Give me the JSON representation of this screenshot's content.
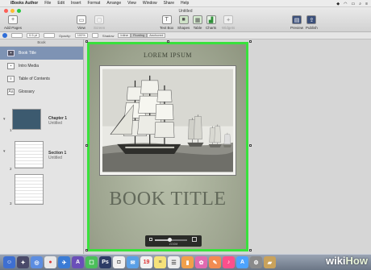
{
  "menubar": {
    "app": "iBooks Author",
    "menus": [
      "File",
      "Edit",
      "Insert",
      "Format",
      "Arrange",
      "View",
      "Window",
      "Share",
      "Help"
    ]
  },
  "window": {
    "title": "Untitled"
  },
  "toolbar": {
    "add_pages": "Add Pages",
    "view": "View",
    "screen": "Screen",
    "text_box": "Text Box",
    "shapes": "Shapes",
    "table": "Table",
    "charts": "Charts",
    "widgets": "Widgets",
    "preview": "Preview",
    "publish": "Publish"
  },
  "formatbar": {
    "stroke_width": "0.5 pt",
    "opacity_label": "Opacity:",
    "opacity_value": "100%",
    "shadow_label": "Shadow",
    "wrap_modes": [
      "Inline",
      "Floating",
      "Anchored"
    ],
    "selected_wrap": "Floating"
  },
  "sidebar": {
    "header": "Book",
    "items": [
      {
        "label": "Book Title",
        "active": true
      },
      {
        "label": "Intro Media",
        "active": false
      },
      {
        "label": "Table of Contents",
        "active": false
      },
      {
        "label": "Glossary",
        "active": false
      }
    ],
    "chapters": [
      {
        "num": "1",
        "title": "Chapter 1",
        "subtitle": "Untitled"
      },
      {
        "num": "2",
        "title": "Section 1",
        "subtitle": "Untitled"
      },
      {
        "num": "3",
        "title": "",
        "subtitle": ""
      }
    ]
  },
  "page": {
    "heading": "LOREM IPSUM",
    "title": "BOOK TITLE"
  },
  "zoom": {
    "label": "ZOOM",
    "level": 0.45
  },
  "watermark": {
    "wiki": "wiki",
    "how": "How"
  },
  "colors": {
    "selection": "#39e13c",
    "sidebar_active": "#7e93b4",
    "page_bg": "#9da48f"
  }
}
